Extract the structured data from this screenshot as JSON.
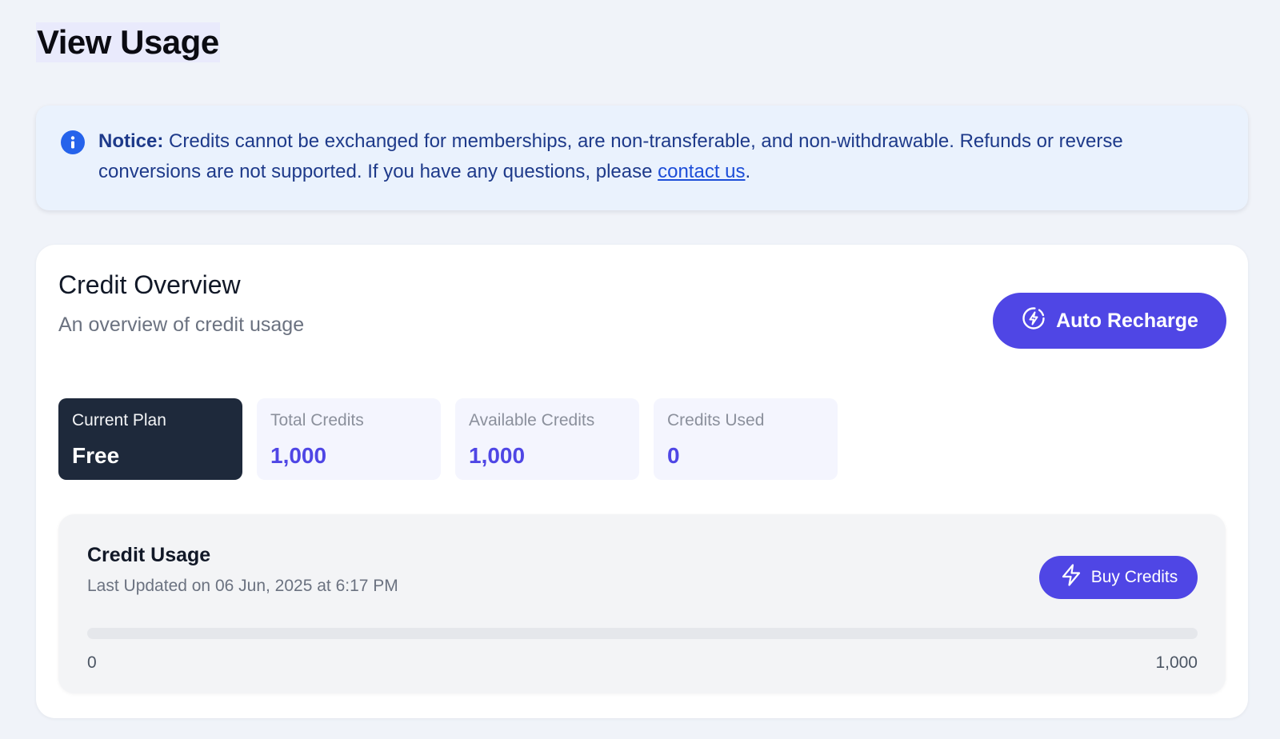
{
  "page": {
    "title": "View Usage"
  },
  "notice": {
    "icon": "info-icon",
    "label": "Notice:",
    "text": "Credits cannot be exchanged for memberships, are non-transferable, and non-withdrawable. Refunds or reverse conversions are not supported. If you have any questions, please",
    "link_text": "contact us",
    "trailing": "."
  },
  "credit_overview": {
    "title": "Credit Overview",
    "subtitle": "An overview of credit usage",
    "auto_recharge_label": "Auto Recharge",
    "auto_recharge_icon": "recharge-icon",
    "stats": [
      {
        "label": "Current Plan",
        "value": "Free"
      },
      {
        "label": "Total Credits",
        "value": "1,000"
      },
      {
        "label": "Available Credits",
        "value": "1,000"
      },
      {
        "label": "Credits Used",
        "value": "0"
      }
    ]
  },
  "credit_usage": {
    "title": "Credit Usage",
    "last_updated": "Last Updated on 06 Jun, 2025 at 6:17 PM",
    "buy_credits_label": "Buy Credits",
    "buy_credits_icon": "lightning-icon",
    "progress_fraction": 0,
    "range_min": "0",
    "range_max": "1,000"
  },
  "colors": {
    "accent": "#4f46e5",
    "plan_card": "#1e293b",
    "notice_background": "#eaf2fd",
    "notice_text": "#1e3a8a",
    "info_icon": "#2563eb"
  }
}
